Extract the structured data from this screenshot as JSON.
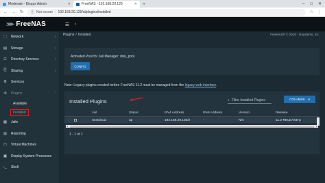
{
  "browser": {
    "tabs": [
      {
        "title": "Moderate - Disqus Admin",
        "favicon_color": "#2e9fff",
        "active": false
      },
      {
        "title": "FreeNAS - 192.168.20.129",
        "favicon_color": "#0e5e9c",
        "active": true
      }
    ],
    "new_tab": "+",
    "address": {
      "security": "Not secure",
      "url": "192.168.20.129/ui/plugins/installed"
    }
  },
  "header": {
    "brand": "FreeNAS",
    "menu_icon": "menu-icon",
    "back_icon": "chevron-left-icon"
  },
  "sidebar": {
    "items": [
      {
        "label": "Network",
        "icon": "network-icon",
        "glyph": "⬚",
        "chevron": "›"
      },
      {
        "label": "Storage",
        "icon": "storage-icon",
        "glyph": "▤",
        "chevron": "›"
      },
      {
        "label": "Directory Services",
        "icon": "directory-icon",
        "glyph": "☷",
        "chevron": "›"
      },
      {
        "label": "Sharing",
        "icon": "sharing-icon",
        "glyph": "⎘",
        "chevron": "›"
      },
      {
        "label": "Services",
        "icon": "services-icon",
        "glyph": "⚙",
        "chevron": ""
      },
      {
        "label": "Plugins",
        "icon": "plugins-icon",
        "glyph": "✣",
        "chevron": "ˇ"
      }
    ],
    "plugins_sub": [
      {
        "label": "Available"
      },
      {
        "label": "Installed"
      }
    ],
    "items_after": [
      {
        "label": "Jails",
        "icon": "jails-icon",
        "glyph": "▦",
        "chevron": ""
      },
      {
        "label": "Reporting",
        "icon": "reporting-icon",
        "glyph": "▥",
        "chevron": ""
      },
      {
        "label": "Virtual Machines",
        "icon": "vm-icon",
        "glyph": "▭",
        "chevron": ""
      },
      {
        "label": "Display System Processes",
        "icon": "processes-icon",
        "glyph": "▣",
        "chevron": ""
      },
      {
        "label": "Shell",
        "icon": "shell-icon",
        "glyph": "›_",
        "chevron": ""
      }
    ]
  },
  "breadcrumb": {
    "parts": [
      "Plugins",
      "/",
      "Installed"
    ],
    "copyright": "FreeNAS® © 2019 - iXsystems, Inc."
  },
  "pool": {
    "text": "Activated Pool for Jail Manager: disk_pool",
    "config_label": "CONFIG"
  },
  "note": {
    "prefix": "Note: Legacy plugins created before FreeNAS 11.2 must be managed from the ",
    "link": "legacy web interface",
    "suffix": "."
  },
  "plugins_table": {
    "title": "Installed Plugins",
    "filter_placeholder": "Filter Installed Plugins",
    "columns_label": "COLUMNS",
    "headers": [
      "Jail",
      "Status",
      "IPv4 Address",
      "IPv6 Address",
      "Version",
      "Release"
    ],
    "rows": [
      {
        "jail": "nextcloud",
        "status": "up",
        "ipv4": "192.168.20.130/2",
        "ipv6": "-",
        "version": "N/A",
        "release": "11.2-RELEASE-p"
      }
    ],
    "pager": "1 - 1 of 1"
  },
  "colors": {
    "accent": "#1f6fb0",
    "highlight": "#e02020",
    "sidebar_bg": "#22323b",
    "main_bg": "#1c2a33"
  }
}
